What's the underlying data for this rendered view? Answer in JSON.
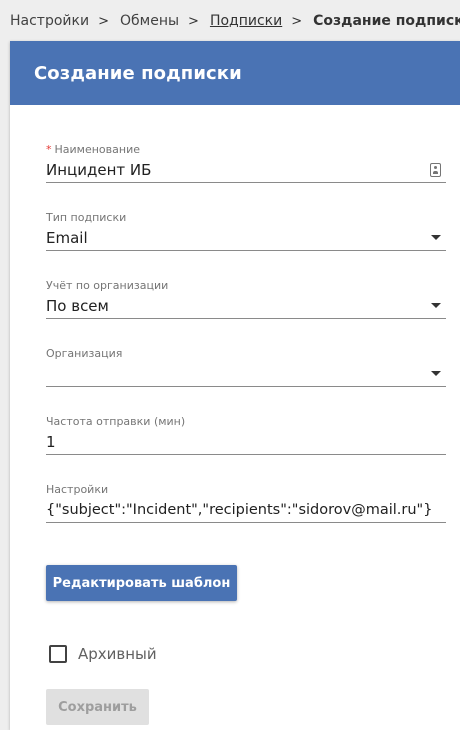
{
  "breadcrumbs": {
    "items": [
      {
        "label": "Настройки"
      },
      {
        "label": "Обмены"
      },
      {
        "label": "Подписки"
      }
    ],
    "current": "Создание подписки",
    "separator": ">"
  },
  "header": {
    "title": "Создание подписки",
    "color": "#4a73b4"
  },
  "form": {
    "name": {
      "label": "Наименование",
      "required_mark": "*",
      "value": "Инцидент ИБ",
      "icon": "id-card-icon"
    },
    "type": {
      "label": "Тип подписки",
      "value": "Email",
      "icon": "dropdown-caret-icon"
    },
    "org_accounting": {
      "label": "Учёт по организации",
      "value": "По всем",
      "icon": "dropdown-caret-icon"
    },
    "organization": {
      "label": "Организация",
      "value": "",
      "icon": "dropdown-caret-icon"
    },
    "frequency": {
      "label": "Частота отправки (мин)",
      "value": "1"
    },
    "settings": {
      "label": "Настройки",
      "value": "{\"subject\":\"Incident\",\"recipients\":\"sidorov@mail.ru\"}"
    }
  },
  "buttons": {
    "edit_template": "Редактировать шаблон",
    "save": "Сохранить"
  },
  "archive": {
    "label": "Архивный",
    "checked": false
  }
}
